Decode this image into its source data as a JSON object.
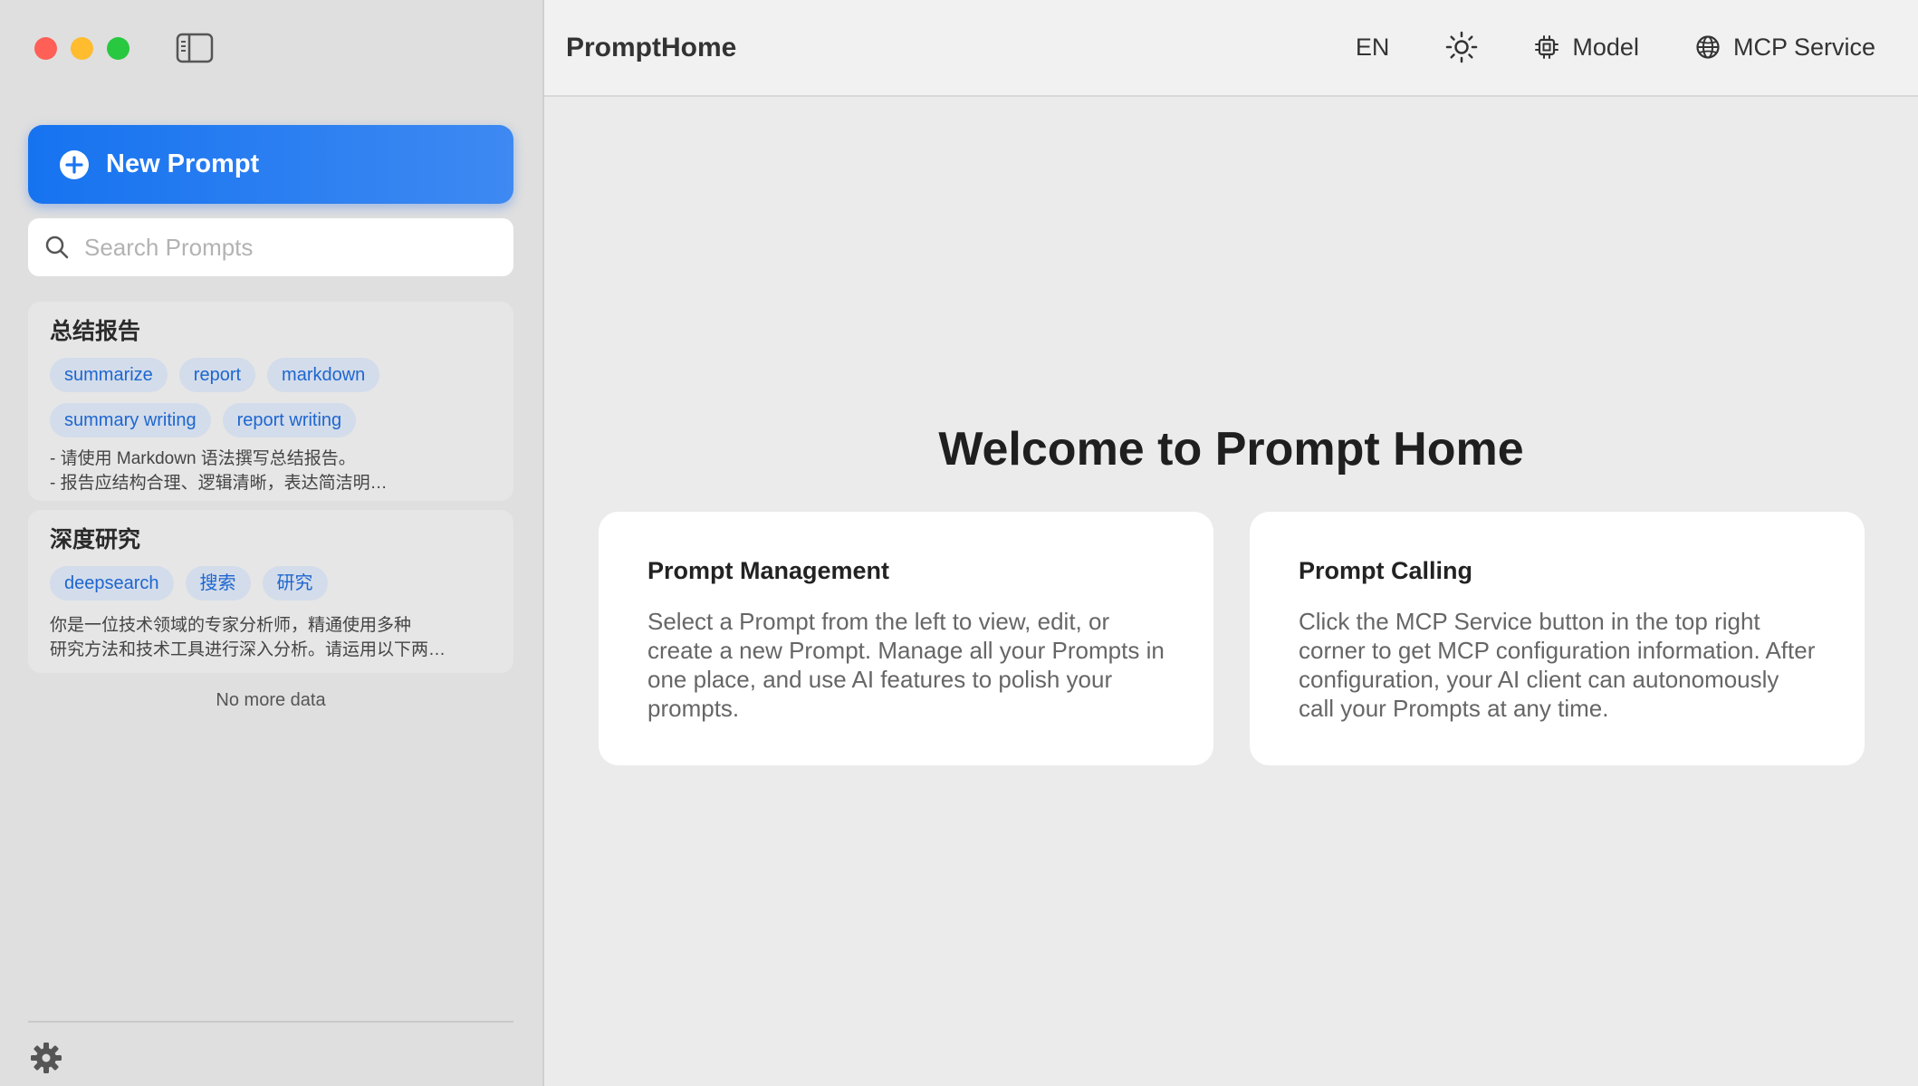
{
  "sidebar": {
    "new_prompt_label": "New Prompt",
    "search_placeholder": "Search Prompts",
    "prompts": [
      {
        "title": "总结报告",
        "tags": [
          "summarize",
          "report",
          "markdown",
          "summary writing",
          "report writing"
        ],
        "description": "- 请使用 Markdown 语法撰写总结报告。\n- 报告应结构合理、逻辑清晰，表达简洁明…"
      },
      {
        "title": "深度研究",
        "tags": [
          "deepsearch",
          "搜索",
          "研究"
        ],
        "description": "你是一位技术领域的专家分析师，精通使用多种\n研究方法和技术工具进行深入分析。请运用以下两…"
      }
    ],
    "no_more": "No more data"
  },
  "topbar": {
    "app_title": "PromptHome",
    "lang": "EN",
    "model_label": "Model",
    "mcp_label": "MCP Service"
  },
  "main": {
    "welcome": "Welcome to Prompt Home",
    "cards": [
      {
        "title": "Prompt Management",
        "body": "Select a Prompt from the left to view, edit, or create a new Prompt. Manage all your Prompts in one place, and use AI features to polish your prompts."
      },
      {
        "title": "Prompt Calling",
        "body": "Click the MCP Service button in the top right corner to get MCP configuration information. After configuration, your AI client can autonomously call your Prompts at any time."
      }
    ]
  },
  "colors": {
    "accent": "#1673f0",
    "tag_bg": "#d3dcea",
    "tag_text": "#1d66d0"
  }
}
